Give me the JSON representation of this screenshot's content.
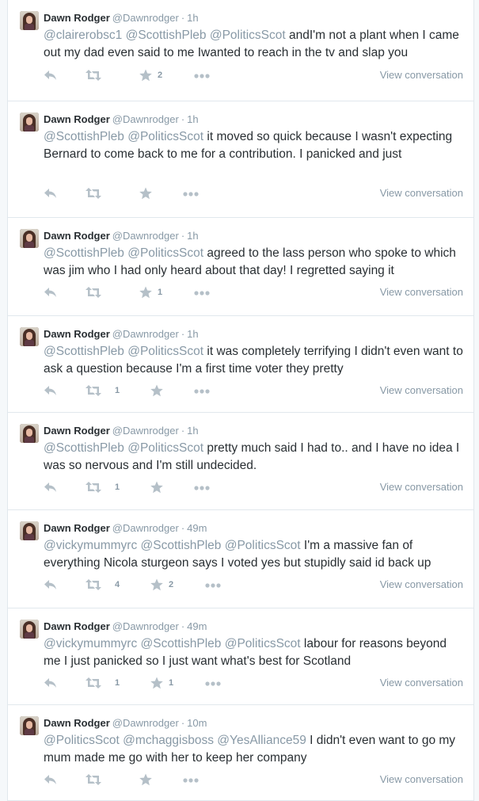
{
  "colors": {
    "text": "#292f33",
    "muted": "#8899a6",
    "border": "#e1e8ed",
    "icon": "#b5c0c8"
  },
  "tweets": [
    {
      "fullname": "Dawn Rodger",
      "username": "@Dawnrodger",
      "time": "1h",
      "segments": [
        {
          "text": "@clairerobsc1",
          "mention": true
        },
        {
          "text": " "
        },
        {
          "text": "@ScottishPleb",
          "mention": true
        },
        {
          "text": " "
        },
        {
          "text": "@PoliticsScot",
          "mention": true
        },
        {
          "text": " andI'm not a plant when I came out my dad even said to me Iwanted to reach in the tv and slap you"
        }
      ],
      "retweets": "",
      "favorites": "2",
      "view_label": "View conversation"
    },
    {
      "fullname": "Dawn Rodger",
      "username": "@Dawnrodger",
      "time": "1h",
      "segments": [
        {
          "text": "@ScottishPleb",
          "mention": true
        },
        {
          "text": " "
        },
        {
          "text": "@PoliticsScot",
          "mention": true
        },
        {
          "text": " it moved so quick because I wasn't expecting Bernard to come back to me for a contribution. I panicked and just"
        }
      ],
      "retweets": "",
      "favorites": "",
      "view_label": "View conversation"
    },
    {
      "fullname": "Dawn Rodger",
      "username": "@Dawnrodger",
      "time": "1h",
      "segments": [
        {
          "text": "@ScottishPleb",
          "mention": true
        },
        {
          "text": " "
        },
        {
          "text": "@PoliticsScot",
          "mention": true
        },
        {
          "text": " agreed to the lass person who spoke to which was jim who I had only heard about that day! I regretted saying it"
        }
      ],
      "retweets": "",
      "favorites": "1",
      "view_label": "View conversation"
    },
    {
      "fullname": "Dawn Rodger",
      "username": "@Dawnrodger",
      "time": "1h",
      "segments": [
        {
          "text": "@ScottishPleb",
          "mention": true
        },
        {
          "text": " "
        },
        {
          "text": "@PoliticsScot",
          "mention": true
        },
        {
          "text": " it was completely terrifying I didn't even want to ask a question because I'm a first time voter they pretty"
        }
      ],
      "retweets": "1",
      "favorites": "",
      "view_label": "View conversation"
    },
    {
      "fullname": "Dawn Rodger",
      "username": "@Dawnrodger",
      "time": "1h",
      "segments": [
        {
          "text": "@ScottishPleb",
          "mention": true
        },
        {
          "text": " "
        },
        {
          "text": "@PoliticsScot",
          "mention": true
        },
        {
          "text": " pretty much said I had to.. and I have no idea I was so nervous and I'm still undecided."
        }
      ],
      "retweets": "1",
      "favorites": "",
      "view_label": "View conversation"
    },
    {
      "fullname": "Dawn Rodger",
      "username": "@Dawnrodger",
      "time": "49m",
      "segments": [
        {
          "text": "@vickymummyrc",
          "mention": true
        },
        {
          "text": " "
        },
        {
          "text": "@ScottishPleb",
          "mention": true
        },
        {
          "text": " "
        },
        {
          "text": "@PoliticsScot",
          "mention": true
        },
        {
          "text": " I'm a massive fan of everything Nicola sturgeon says I voted yes but stupidly said id back up"
        }
      ],
      "retweets": "4",
      "favorites": "2",
      "view_label": "View conversation"
    },
    {
      "fullname": "Dawn Rodger",
      "username": "@Dawnrodger",
      "time": "49m",
      "segments": [
        {
          "text": "@vickymummyrc",
          "mention": true
        },
        {
          "text": " "
        },
        {
          "text": "@ScottishPleb",
          "mention": true
        },
        {
          "text": " "
        },
        {
          "text": "@PoliticsScot",
          "mention": true
        },
        {
          "text": " labour for reasons beyond me I just panicked so I just want what's best for Scotland"
        }
      ],
      "retweets": "1",
      "favorites": "1",
      "view_label": "View conversation"
    },
    {
      "fullname": "Dawn Rodger",
      "username": "@Dawnrodger",
      "time": "10m",
      "segments": [
        {
          "text": "@PoliticsScot",
          "mention": true
        },
        {
          "text": " "
        },
        {
          "text": "@mchaggisboss",
          "mention": true
        },
        {
          "text": " "
        },
        {
          "text": "@YesAlliance59",
          "mention": true
        },
        {
          "text": " I didn't even want to go my mum made me go with her to keep her company"
        }
      ],
      "retweets": "",
      "favorites": "",
      "view_label": "View conversation"
    }
  ]
}
